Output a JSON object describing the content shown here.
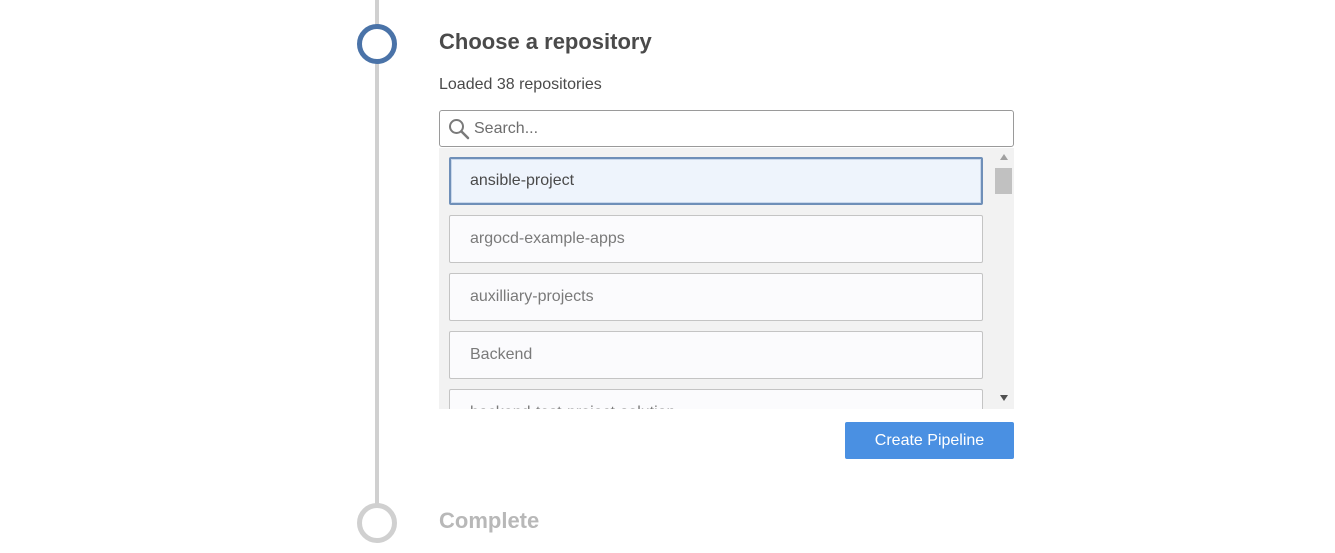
{
  "steps": {
    "active": {
      "title": "Choose a repository"
    },
    "next": {
      "title": "Complete"
    }
  },
  "repositories": {
    "loaded_text": "Loaded 38 repositories",
    "search_placeholder": "Search...",
    "items": [
      {
        "name": "ansible-project",
        "selected": true
      },
      {
        "name": "argocd-example-apps",
        "selected": false
      },
      {
        "name": "auxilliary-projects",
        "selected": false
      },
      {
        "name": "Backend",
        "selected": false
      },
      {
        "name": "backend-test-project-solution",
        "selected": false
      }
    ]
  },
  "actions": {
    "create_pipeline_label": "Create Pipeline"
  },
  "colors": {
    "accent": "#4a90e2",
    "step_active": "#4a73a8",
    "step_inactive": "#d0d0d0"
  },
  "icons": {
    "search": "search-icon"
  }
}
